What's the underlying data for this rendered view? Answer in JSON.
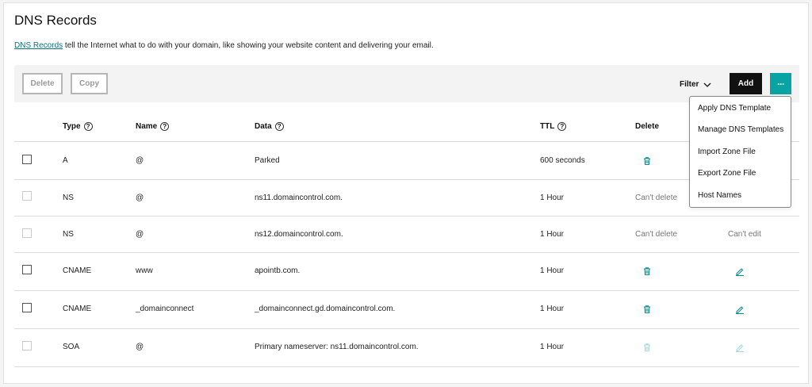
{
  "page": {
    "title": "DNS Records",
    "intro_link": "DNS Records",
    "intro_text": " tell the Internet what to do with your domain, like showing your website content and delivering your email."
  },
  "toolbar": {
    "delete_label": "Delete",
    "copy_label": "Copy",
    "filter_label": "Filter",
    "add_label": "Add",
    "more_label": "···"
  },
  "table": {
    "headers": {
      "type": "Type",
      "name": "Name",
      "data": "Data",
      "ttl": "TTL",
      "delete": "Delete"
    },
    "rows": [
      {
        "type": "A",
        "name": "@",
        "data": "Parked",
        "ttl": "600 seconds",
        "delete": "trash",
        "edit": "none"
      },
      {
        "type": "NS",
        "name": "@",
        "data": "ns11.domaincontrol.com.",
        "ttl": "1 Hour",
        "delete_text": "Can't delete",
        "edit": "none"
      },
      {
        "type": "NS",
        "name": "@",
        "data": "ns12.domaincontrol.com.",
        "ttl": "1 Hour",
        "delete_text": "Can't delete",
        "edit_text": "Can't edit"
      },
      {
        "type": "CNAME",
        "name": "www",
        "data": "apointb.com.",
        "ttl": "1 Hour",
        "delete": "trash",
        "edit": "pencil"
      },
      {
        "type": "CNAME",
        "name": "_domainconnect",
        "data": "_domainconnect.gd.domaincontrol.com.",
        "ttl": "1 Hour",
        "delete": "trash",
        "edit": "pencil"
      },
      {
        "type": "SOA",
        "name": "@",
        "data": "Primary nameserver: ns11.domaincontrol.com.",
        "ttl": "1 Hour",
        "delete": "trash-disabled",
        "edit": "pencil-disabled"
      }
    ]
  },
  "menu": {
    "items": [
      "Apply DNS Template",
      "Manage DNS Templates",
      "Import Zone File",
      "Export Zone File",
      "Host Names"
    ]
  },
  "colors": {
    "accent": "#0aa3a3",
    "link": "#09757a",
    "primary_button": "#111111"
  },
  "icons": {
    "help": "help-circle-icon",
    "filter_chevron": "chevron-down-icon",
    "delete": "trash-icon",
    "edit": "pencil-icon"
  }
}
